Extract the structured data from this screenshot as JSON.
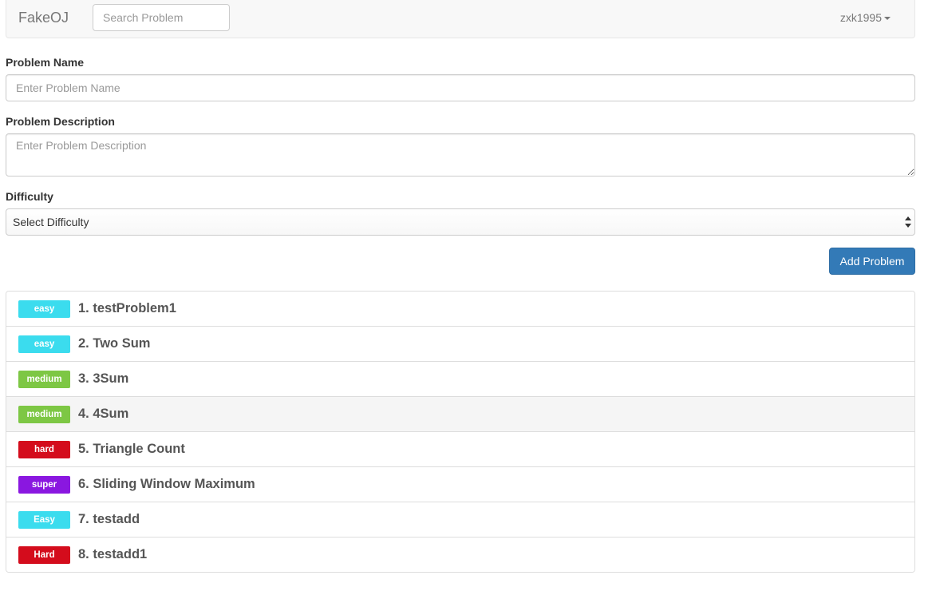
{
  "navbar": {
    "brand": "FakeOJ",
    "search_placeholder": "Search Problem",
    "username": "zxk1995"
  },
  "form": {
    "name_label": "Problem Name",
    "name_placeholder": "Enter Problem Name",
    "description_label": "Problem Description",
    "description_placeholder": "Enter Problem Description",
    "difficulty_label": "Difficulty",
    "difficulty_selected": "Select Difficulty",
    "submit_label": "Add Problem"
  },
  "colors": {
    "easy": "#3bdcee",
    "medium": "#7dc744",
    "hard": "#d40c1c",
    "super": "#8a17e0",
    "primary": "#337ab7"
  },
  "problems": [
    {
      "badge": "easy",
      "level": "easy",
      "title": "1. testProblem1"
    },
    {
      "badge": "easy",
      "level": "easy",
      "title": "2. Two Sum"
    },
    {
      "badge": "medium",
      "level": "medium",
      "title": "3. 3Sum"
    },
    {
      "badge": "medium",
      "level": "medium",
      "title": "4. 4Sum"
    },
    {
      "badge": "hard",
      "level": "hard",
      "title": "5. Triangle Count"
    },
    {
      "badge": "super",
      "level": "super",
      "title": "6. Sliding Window Maximum"
    },
    {
      "badge": "Easy",
      "level": "easy",
      "title": "7. testadd"
    },
    {
      "badge": "Hard",
      "level": "hard",
      "title": "8. testadd1"
    }
  ]
}
